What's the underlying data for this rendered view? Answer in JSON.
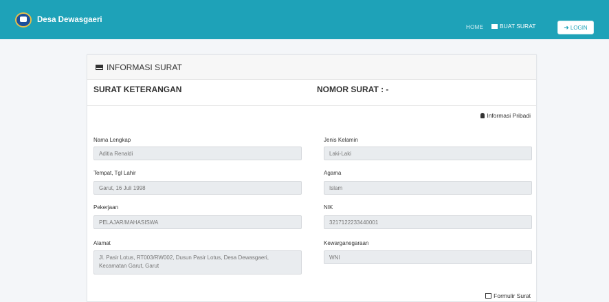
{
  "navbar": {
    "brand": "Desa Dewasgaeri",
    "home": "HOME",
    "buat_surat": "BUAT SURAT",
    "login": "LOGIN"
  },
  "card": {
    "header": "INFORMASI SURAT",
    "surat_keterangan": "SURAT KETERANGAN",
    "nomor_surat": "NOMOR SURAT : -",
    "informasi_pribadi": "Informasi Pribadi",
    "formulir_surat": "Formulir Surat"
  },
  "fields": {
    "nama": {
      "label": "Nama Lengkap",
      "value": "Aditia Renaldi"
    },
    "ttl": {
      "label": "Tempat, Tgl Lahir",
      "value": "Garut, 16 Juli 1998"
    },
    "pekerjaan": {
      "label": "Pekerjaan",
      "value": "PELAJAR/MAHASISWA"
    },
    "alamat": {
      "label": "Alamat",
      "value": "Jl. Pasir Lotus, RT003/RW002, Dusun Pasir Lotus, Desa Dewasgaeri, Kecamatan Garut, Garut"
    },
    "jk": {
      "label": "Jenis Kelamin",
      "value": "Laki-Laki"
    },
    "agama": {
      "label": "Agama",
      "value": "Islam"
    },
    "nik": {
      "label": "NIK",
      "value": "3217122233440001"
    },
    "kewarganegaraan": {
      "label": "Kewarganegaraan",
      "value": "WNI"
    }
  }
}
